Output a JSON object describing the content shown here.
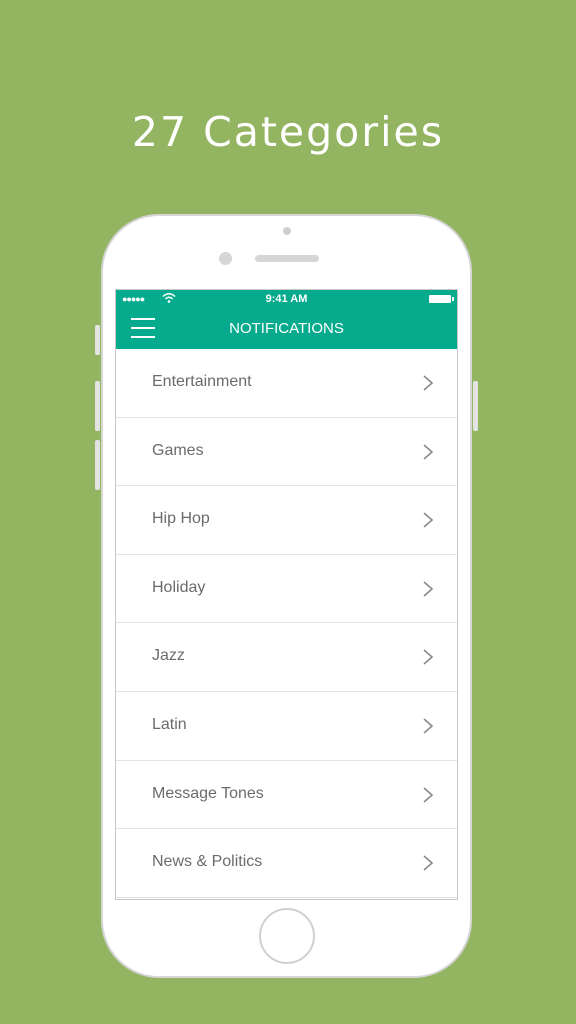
{
  "headline": "27 Categories",
  "status_bar": {
    "signal": "●●●●●",
    "time": "9:41 AM"
  },
  "nav": {
    "title": "NOTIFICATIONS"
  },
  "categories": [
    {
      "label": "Entertainment"
    },
    {
      "label": "Games"
    },
    {
      "label": "Hip Hop"
    },
    {
      "label": "Holiday"
    },
    {
      "label": "Jazz"
    },
    {
      "label": "Latin"
    },
    {
      "label": "Message Tones"
    },
    {
      "label": "News & Politics"
    }
  ],
  "colors": {
    "background": "#93b562",
    "accent": "#06ab8d"
  }
}
